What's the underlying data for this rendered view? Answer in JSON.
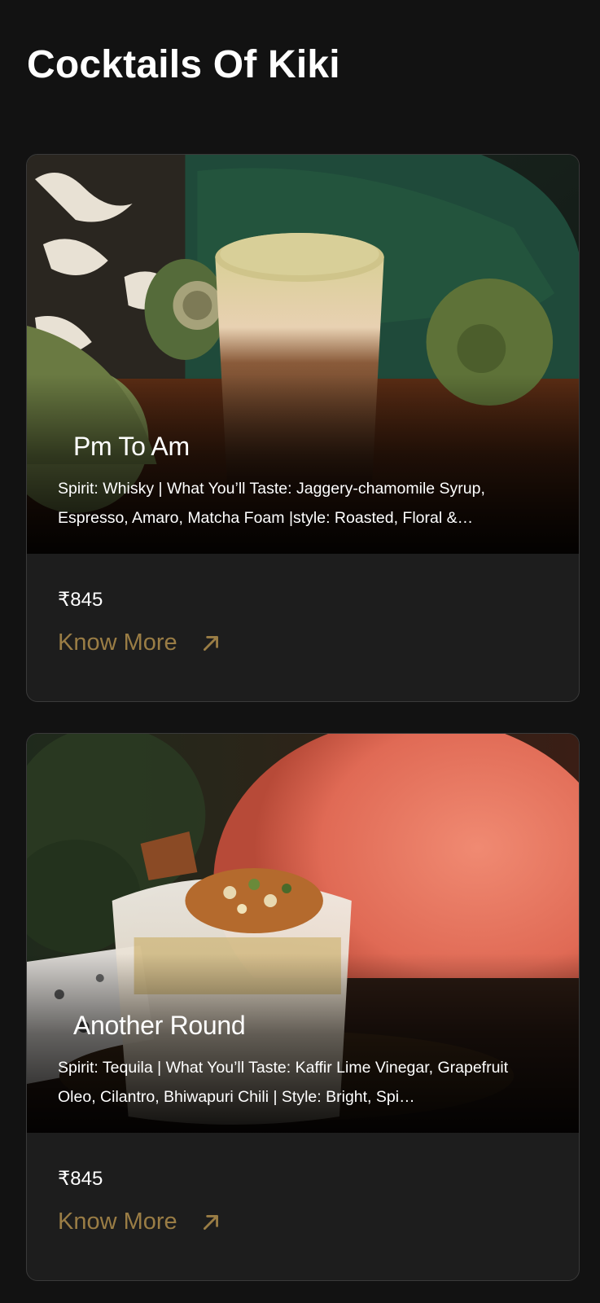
{
  "page": {
    "title": "Cocktails Of Kiki"
  },
  "cocktails": [
    {
      "name": "Pm To Am",
      "description": "Spirit: Whisky | What You’ll Taste: Jaggery-chamomile Syrup, Espresso, Amaro, Matcha Foam |style: Roasted, Floral &…",
      "price": "₹845",
      "cta_label": "Know More",
      "cta_icon": "arrow-up-right-icon"
    },
    {
      "name": "Another Round",
      "description": "Spirit: Tequila | What You’ll Taste: Kaffir Lime Vinegar, Grapefruit Oleo, Cilantro, Bhiwapuri Chili | Style: Bright, Spi…",
      "price": "₹845",
      "cta_label": "Know More",
      "cta_icon": "arrow-up-right-icon"
    }
  ],
  "colors": {
    "background": "#121212",
    "card_background": "#1d1d1d",
    "accent": "#9a7d45"
  }
}
